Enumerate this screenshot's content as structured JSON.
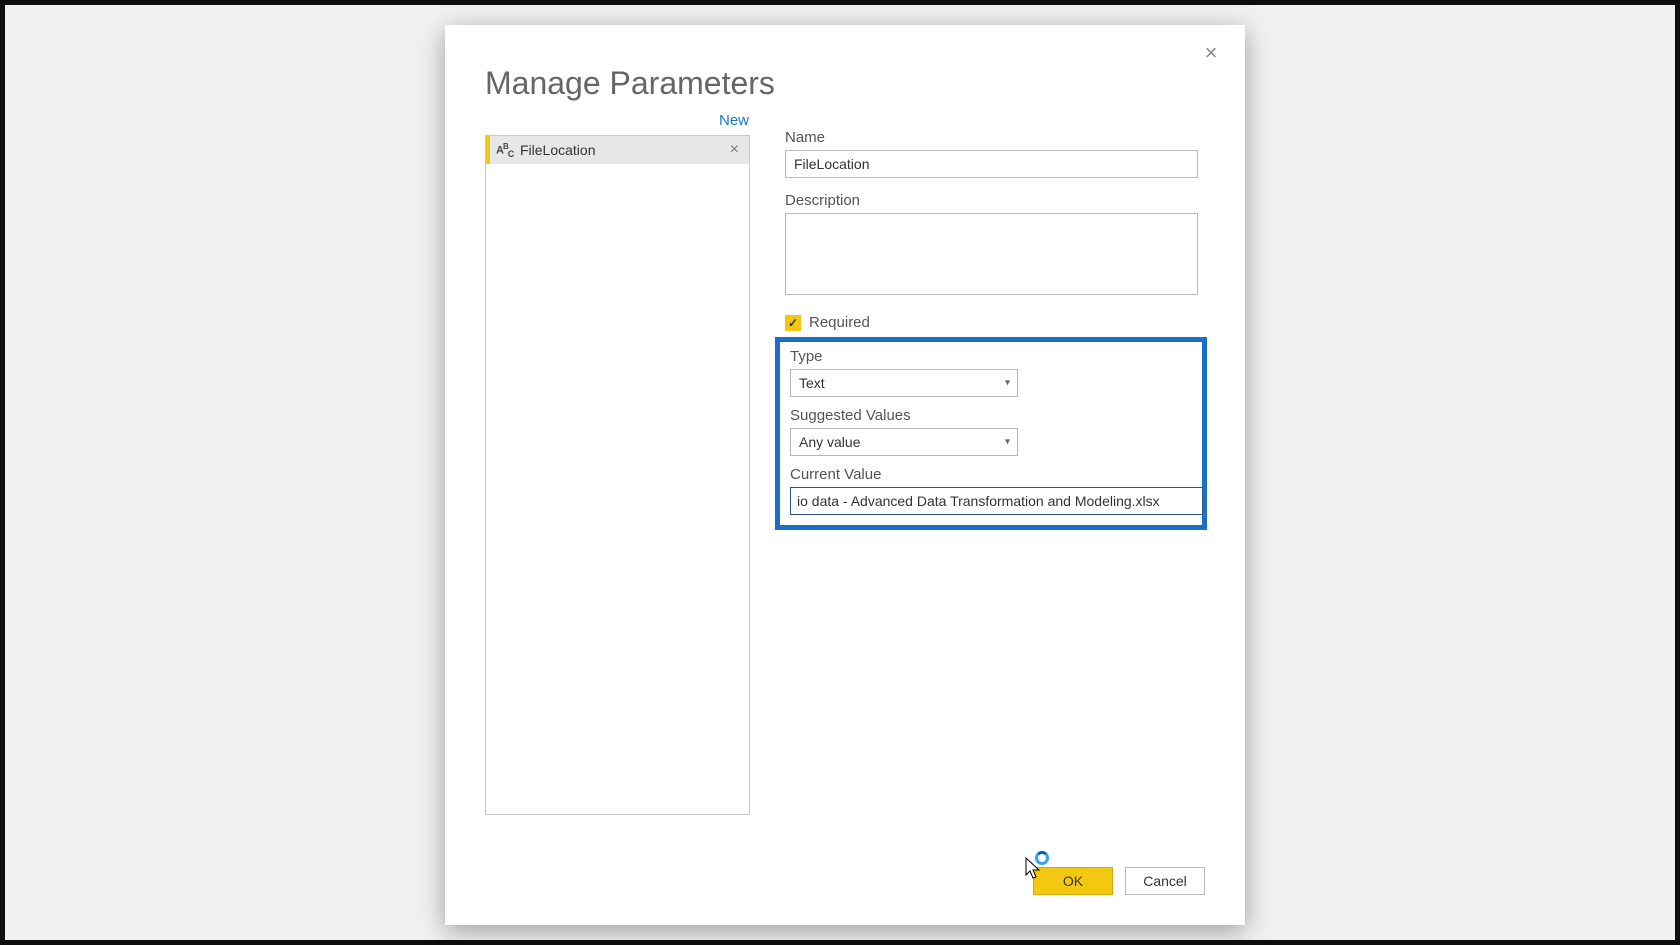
{
  "dialog": {
    "title": "Manage Parameters",
    "new_link": "New"
  },
  "parameters": [
    {
      "type_icon": "ABc",
      "name": "FileLocation"
    }
  ],
  "form": {
    "name_label": "Name",
    "name_value": "FileLocation",
    "description_label": "Description",
    "description_value": "",
    "required_label": "Required",
    "required_checked": true,
    "type_label": "Type",
    "type_value": "Text",
    "suggested_label": "Suggested Values",
    "suggested_value": "Any value",
    "current_label": "Current Value",
    "current_value": "io data - Advanced Data Transformation and Modeling.xlsx"
  },
  "buttons": {
    "ok": "OK",
    "cancel": "Cancel"
  },
  "colors": {
    "accent": "#f2c811",
    "highlight_border": "#1a6fc9",
    "link": "#137ad1"
  }
}
